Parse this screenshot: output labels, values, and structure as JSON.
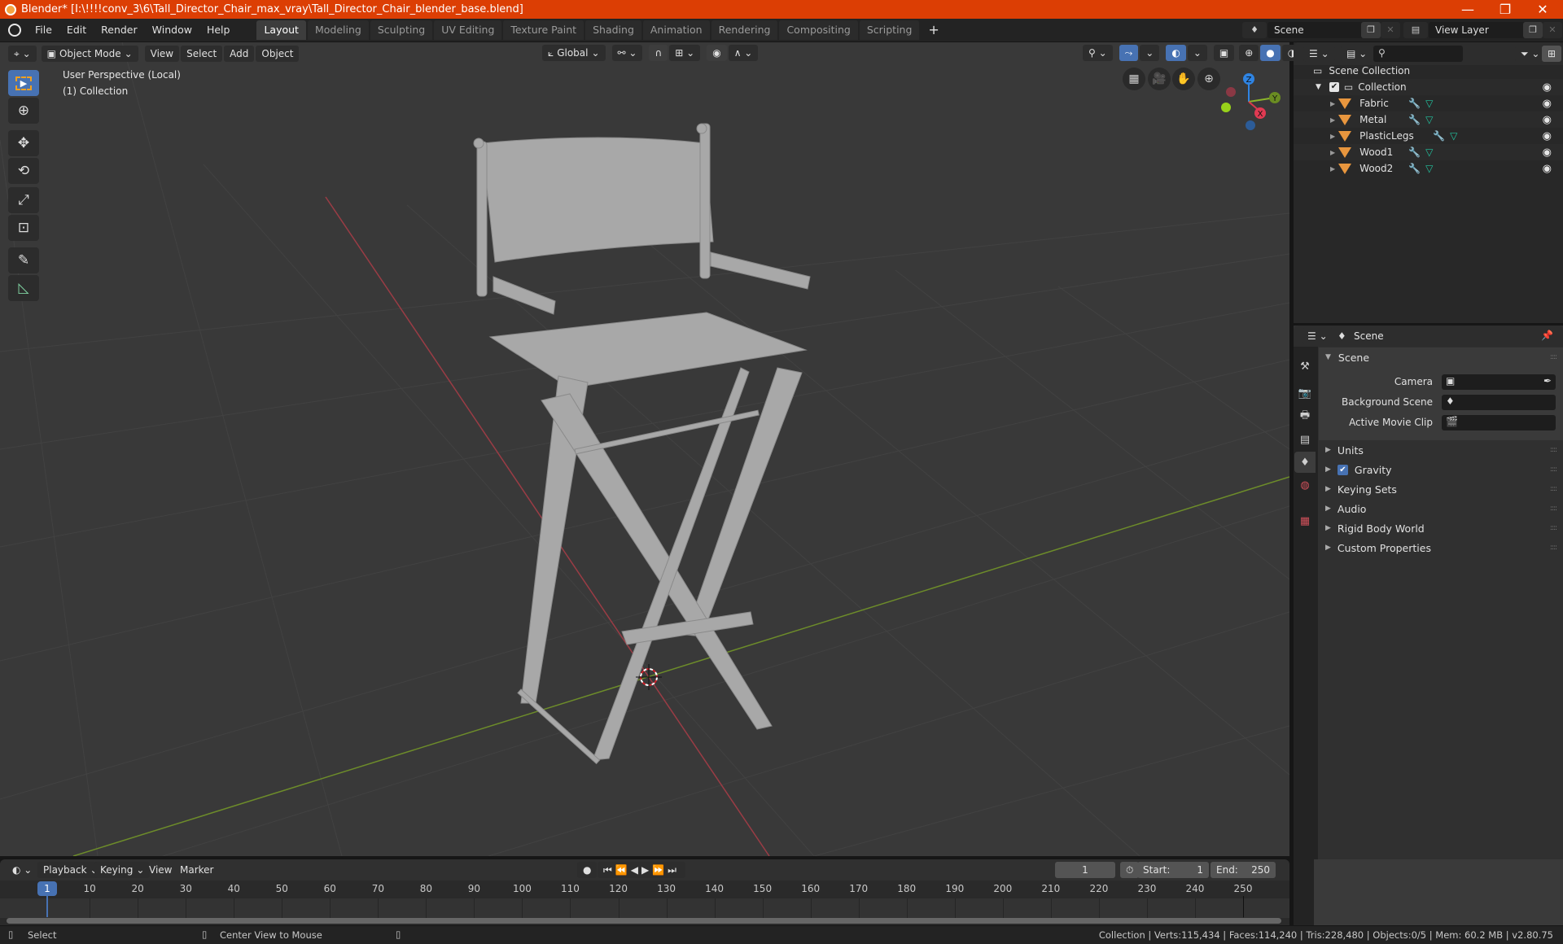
{
  "window": {
    "title": "Blender* [I:\\!!!!conv_3\\6\\Tall_Director_Chair_max_vray\\Tall_Director_Chair_blender_base.blend]",
    "controls": {
      "minimize": "—",
      "maximize": "❐",
      "close": "✕"
    }
  },
  "menu": {
    "items": [
      "File",
      "Edit",
      "Render",
      "Window",
      "Help"
    ],
    "workspaces": [
      "Layout",
      "Modeling",
      "Sculpting",
      "UV Editing",
      "Texture Paint",
      "Shading",
      "Animation",
      "Rendering",
      "Compositing",
      "Scripting"
    ],
    "active_workspace": "Layout",
    "add_workspace": "+",
    "scene_name": "Scene",
    "view_layer_name": "View Layer"
  },
  "viewport": {
    "mode": "Object Mode",
    "menus": [
      "View",
      "Select",
      "Add",
      "Object"
    ],
    "orientation": "Global",
    "info_line1": "User Perspective (Local)",
    "info_line2": "(1) Collection",
    "gizmo": {
      "z": "Z",
      "y": "Y",
      "x": "X"
    },
    "colors": {
      "x_axis": "#d9394e",
      "y_axis": "#8bb42a",
      "z_axis": "#2f84e3",
      "accent": "#4772b3"
    }
  },
  "outliner": {
    "search_placeholder": "",
    "root": "Scene Collection",
    "collection": "Collection",
    "objects": [
      {
        "name": "Fabric"
      },
      {
        "name": "Metal"
      },
      {
        "name": "PlasticLegs"
      },
      {
        "name": "Wood1"
      },
      {
        "name": "Wood2"
      }
    ]
  },
  "properties": {
    "context": "Scene",
    "panel_title": "Scene",
    "fields": [
      {
        "label": "Camera",
        "value": ""
      },
      {
        "label": "Background Scene",
        "value": ""
      },
      {
        "label": "Active Movie Clip",
        "value": ""
      }
    ],
    "sections": [
      {
        "label": "Units"
      },
      {
        "label": "Gravity",
        "checkbox": true
      },
      {
        "label": "Keying Sets"
      },
      {
        "label": "Audio"
      },
      {
        "label": "Rigid Body World"
      },
      {
        "label": "Custom Properties"
      }
    ]
  },
  "timeline": {
    "menus": [
      "Playback",
      "Keying",
      "View",
      "Marker"
    ],
    "current_frame": "1",
    "start_label": "Start:",
    "start": "1",
    "end_label": "End:",
    "end": "250",
    "ticks": [
      "10",
      "20",
      "30",
      "40",
      "50",
      "60",
      "70",
      "80",
      "90",
      "100",
      "110",
      "120",
      "130",
      "140",
      "150",
      "160",
      "170",
      "180",
      "190",
      "200",
      "210",
      "220",
      "230",
      "240",
      "250"
    ],
    "playhead": "1"
  },
  "status": {
    "left_action": "Select",
    "middle_action": "Center View to Mouse",
    "stats": "Collection | Verts:115,434 | Faces:114,240 | Tris:228,480 | Objects:0/5 | Mem: 60.2 MB | v2.80.75"
  }
}
